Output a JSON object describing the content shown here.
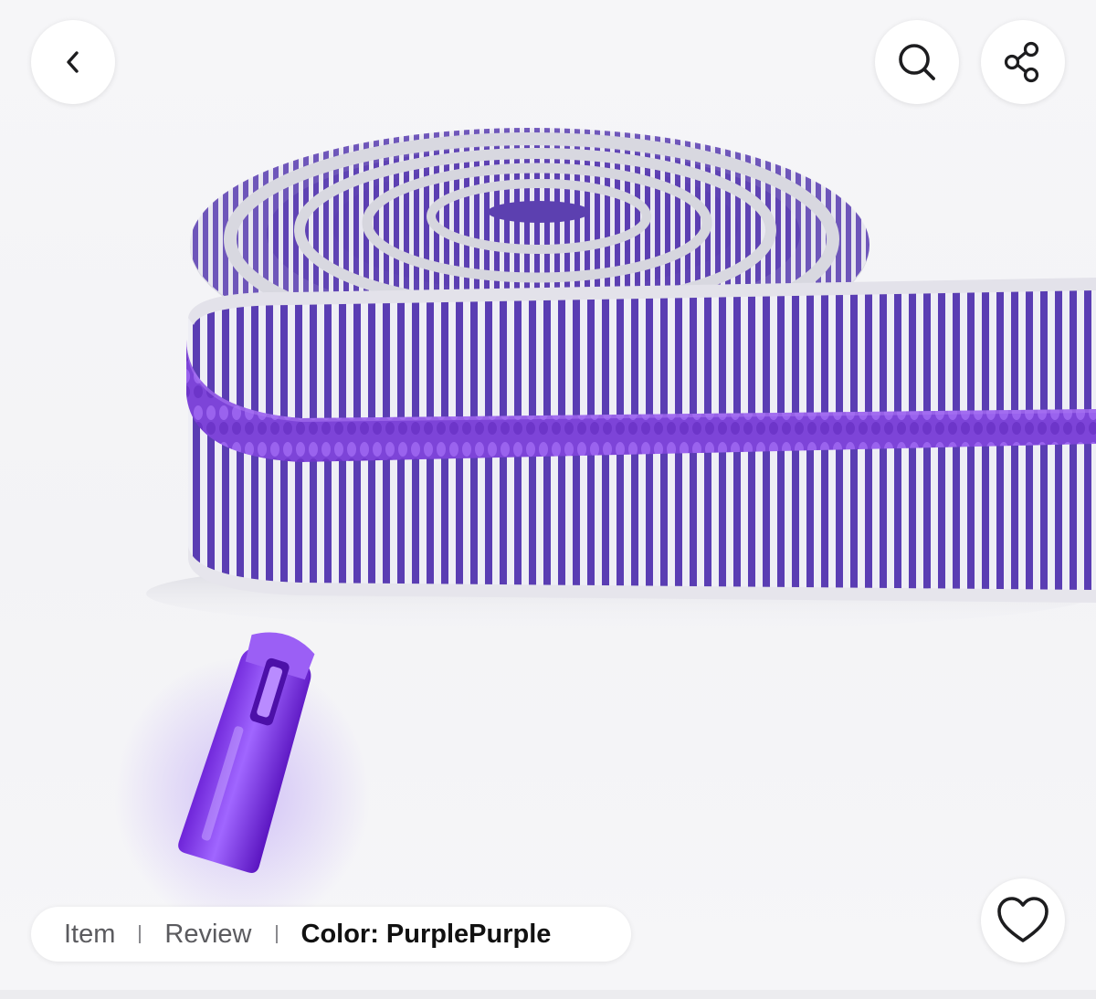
{
  "header": {
    "back_icon": "chevron-left-icon",
    "search_icon": "search-icon",
    "share_icon": "share-icon"
  },
  "product_image": {
    "subject": "zipper-tape-roll-with-slider",
    "colors": {
      "tape_purple": "#5b3fb5",
      "coil_purple": "#8a4fe0",
      "slider_purple": "#8b3ff0",
      "tape_white": "#e9e8f0"
    }
  },
  "tabs": {
    "items": [
      {
        "label": "Item"
      },
      {
        "label": "Review"
      },
      {
        "label": "Color: PurplePurple"
      }
    ],
    "active_index": 2
  },
  "favorite": {
    "icon": "heart-icon"
  }
}
